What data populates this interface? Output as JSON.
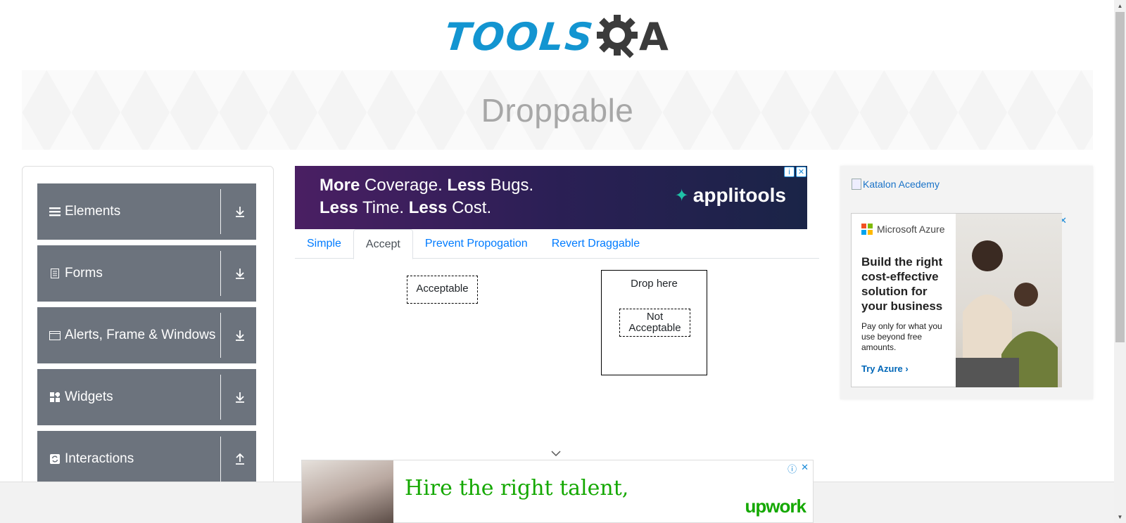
{
  "header": {
    "logo_tools": "TOOLS",
    "logo_a": "A"
  },
  "banner": {
    "title": "Droppable"
  },
  "sidebar": {
    "groups": [
      {
        "label": "Elements",
        "icon": "menu-icon",
        "expanded": false
      },
      {
        "label": "Forms",
        "icon": "document-icon",
        "expanded": false
      },
      {
        "label": "Alerts, Frame & Windows",
        "icon": "window-icon",
        "expanded": false
      },
      {
        "label": "Widgets",
        "icon": "widgets-icon",
        "expanded": false
      },
      {
        "label": "Interactions",
        "icon": "refresh-icon",
        "expanded": true
      }
    ]
  },
  "ad_top": {
    "w1": "More",
    "w2": " Coverage. ",
    "w3": "Less",
    "w4": " Bugs.",
    "w5": "Less",
    "w6": " Time. ",
    "w7": "Less",
    "w8": " Cost.",
    "brand": "applitools",
    "colors": {
      "from": "#4a1f63",
      "to": "#1a2447",
      "brand_mark": "#1fc3a8"
    }
  },
  "tabs": {
    "items": [
      "Simple",
      "Accept",
      "Prevent Propogation",
      "Revert Draggable"
    ],
    "active": "Accept"
  },
  "accept_panel": {
    "acceptable_label": "Acceptable",
    "drop_label": "Drop here",
    "not_acceptable_label": "Not Acceptable"
  },
  "ad_right": {
    "katalon_alt": "Katalon Acedemy",
    "brand": "Microsoft Azure",
    "headline": "Build the right cost-effective solution for your business",
    "sub": "Pay only for what you use beyond free amounts.",
    "cta": "Try Azure ›"
  },
  "ad_bottom": {
    "headline": "Hire the right talent,",
    "brand": "upwork",
    "color": "#14a800"
  },
  "colors": {
    "logo_blue": "#1395d1",
    "logo_dark": "#3b3b3b",
    "sidebar_group": "#6c737d",
    "link": "#007bff"
  }
}
